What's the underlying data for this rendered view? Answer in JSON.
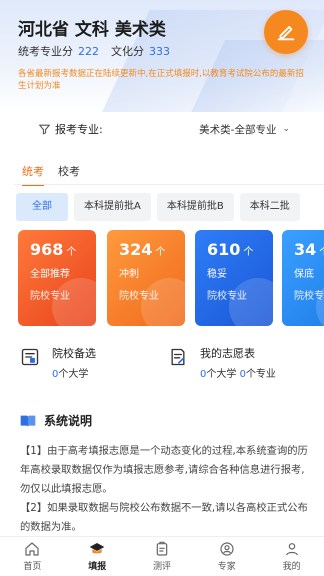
{
  "header": {
    "title": "河北省 文科 美术类",
    "major_score_label": "统考专业分",
    "major_score": "222",
    "culture_score_label": "文化分",
    "culture_score": "333",
    "notice": "各省最新报考数据正在陆续更新中,在正式填报时,以教育考试院公布的最新招生计划为准"
  },
  "major_select": {
    "label": "报考专业:",
    "value": "美术类-全部专业"
  },
  "tabs": [
    {
      "label": "统考",
      "active": true
    },
    {
      "label": "校考",
      "active": false
    }
  ],
  "batch_chips": [
    "全部",
    "本科提前批A",
    "本科提前批B",
    "本科二批"
  ],
  "cards": [
    {
      "count": "968",
      "unit": "个",
      "name": "全部推荐",
      "sub": "院校专业"
    },
    {
      "count": "324",
      "unit": "个",
      "name": "冲刺",
      "sub": "院校专业"
    },
    {
      "count": "610",
      "unit": "个",
      "name": "稳妥",
      "sub": "院校专业"
    },
    {
      "count": "34",
      "unit": "个",
      "name": "保底",
      "sub": "院校专业"
    }
  ],
  "utilities": {
    "candidates": {
      "title": "院校备选",
      "count": "0",
      "count_unit": "个大学"
    },
    "my_plan": {
      "title": "我的志愿表",
      "count1": "0",
      "count1_unit": "个大学",
      "count2": "0",
      "count2_unit": "个专业"
    }
  },
  "system_note": {
    "title": "系统说明",
    "paragraphs": [
      "【1】由于高考填报志愿是一个动态变化的过程,本系统查询的历年高校录取数据仅作为填报志愿参考,请综合各种信息进行报考,勿仅以此填报志愿。",
      "【2】如果录取数据与院校公布数据不一致,请以各高校正式公布的数据为准。"
    ]
  },
  "bottom_nav": [
    {
      "label": "首页",
      "icon": "home-icon",
      "active": false
    },
    {
      "label": "填报",
      "icon": "graduation-cap-icon",
      "active": true
    },
    {
      "label": "测评",
      "icon": "clipboard-icon",
      "active": false
    },
    {
      "label": "专家",
      "icon": "expert-icon",
      "active": false
    },
    {
      "label": "我的",
      "icon": "user-icon",
      "active": false
    }
  ],
  "colors": {
    "accent_orange": "#f06d1a",
    "accent_blue": "#2f6fe4",
    "notice_orange": "#f28a1b"
  }
}
